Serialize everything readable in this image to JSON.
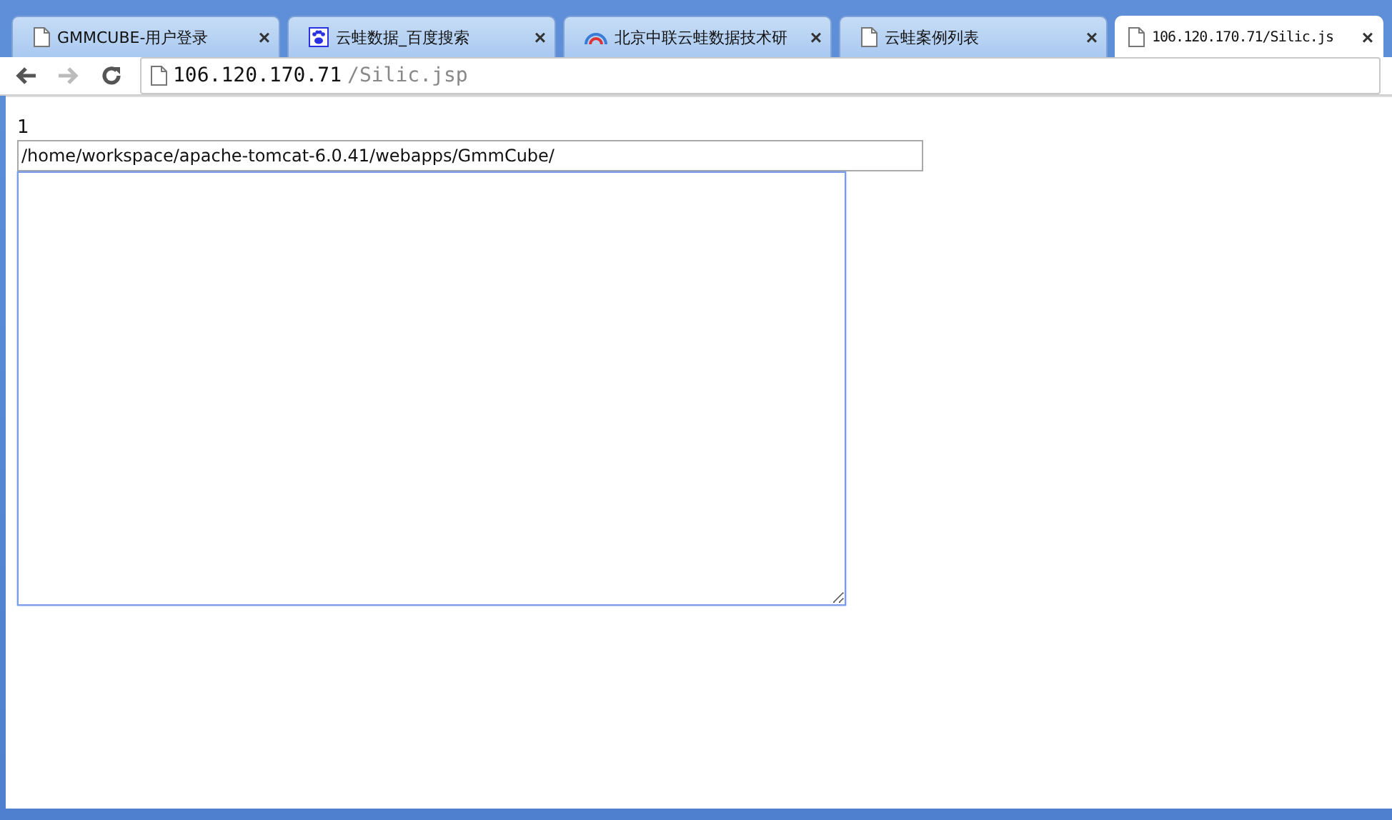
{
  "tabs": [
    {
      "title": "GMMCUBE-用户登录",
      "kind": "page",
      "selected": false,
      "close": "×"
    },
    {
      "title": "云蛙数据_百度搜索",
      "kind": "paw",
      "selected": false,
      "close": "×"
    },
    {
      "title": "北京中联云蛙数据技术研",
      "kind": "signal",
      "selected": false,
      "close": "×"
    },
    {
      "title": "云蛙案例列表",
      "kind": "page",
      "selected": false,
      "close": "×"
    },
    {
      "title": "106.120.170.71/Silic.js",
      "kind": "page",
      "selected": true,
      "close": "×"
    }
  ],
  "address_bar": {
    "host": "106.120.170.71",
    "path": "/Silic.jsp"
  },
  "page": {
    "number": "1",
    "path_field": "/home/workspace/apache-tomcat-6.0.41/webapps/GmmCube/",
    "content_area": {
      "focused": true
    }
  }
}
